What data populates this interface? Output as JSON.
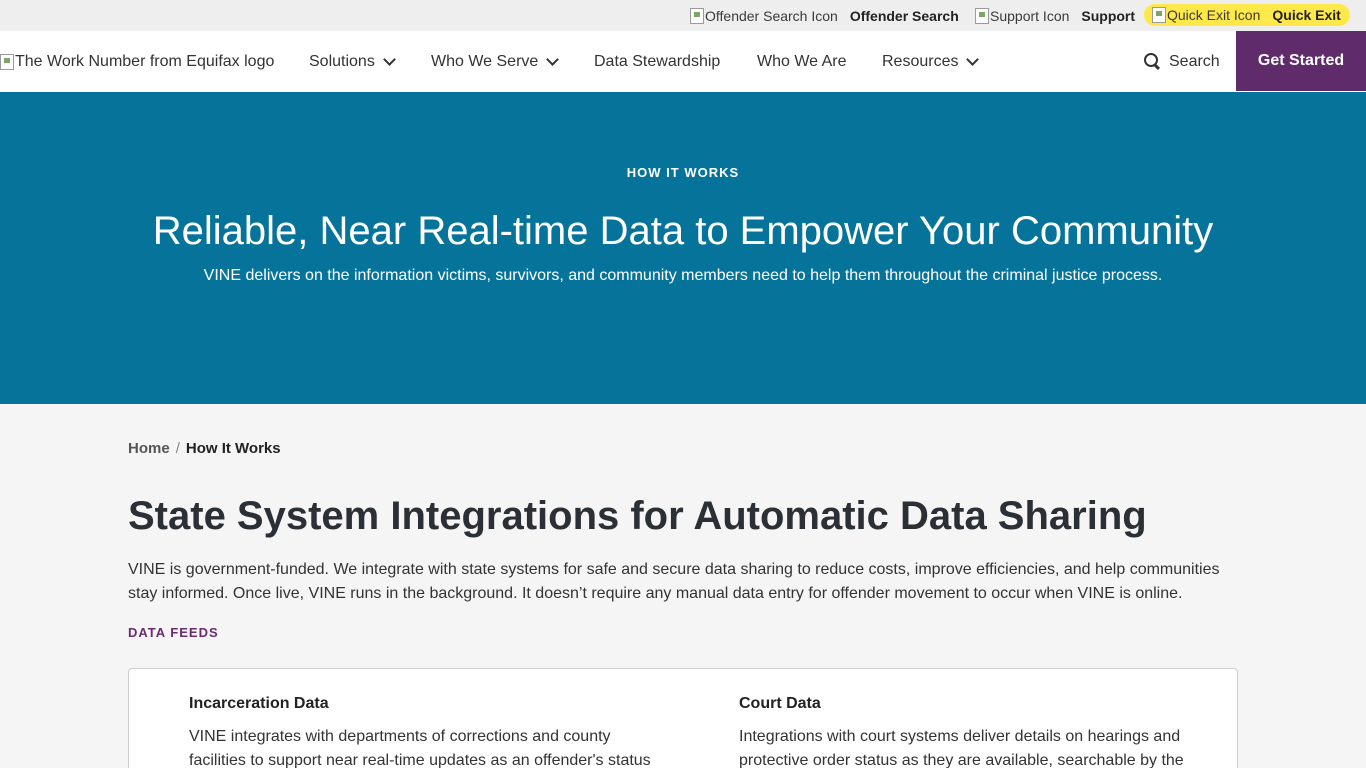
{
  "utility_bar": {
    "offender_search_icon_alt": "Offender Search Icon",
    "offender_search_label": "Offender Search",
    "support_icon_alt": "Support Icon",
    "support_label": "Support",
    "quick_exit_icon_alt": "Quick Exit Icon",
    "quick_exit_label": "Quick Exit",
    "quick_exit_color": "#ffe94a"
  },
  "nav": {
    "logo_alt": "The Work Number from Equifax logo",
    "items": [
      {
        "label": "Solutions",
        "has_dropdown": true
      },
      {
        "label": "Who We Serve",
        "has_dropdown": true
      },
      {
        "label": "Data Stewardship",
        "has_dropdown": false
      },
      {
        "label": "Who We Are",
        "has_dropdown": false
      },
      {
        "label": "Resources",
        "has_dropdown": true
      }
    ],
    "search_label": "Search",
    "cta_label": "Get Started",
    "cta_color": "#5f2b6b"
  },
  "hero": {
    "eyebrow": "HOW IT WORKS",
    "title": "Reliable, Near Real-time Data to Empower Your Community",
    "subtitle": "VINE delivers on the information victims, survivors, and community members need to help them throughout the criminal justice process.",
    "background_color": "#06739b"
  },
  "breadcrumb": {
    "home": "Home",
    "separator": "/",
    "current": "How It Works"
  },
  "main": {
    "title": "State System Integrations for Automatic Data Sharing",
    "intro": "VINE is government-funded. We integrate with state systems for safe and secure data sharing to reduce costs, improve efficiencies, and help communities stay informed. Once live, VINE runs in the background. It doesn’t require any manual data entry for offender movement to occur when VINE is online.",
    "feeds_label": "DATA FEEDS",
    "feeds": [
      {
        "title": "Incarceration Data",
        "text": "VINE integrates with departments of corrections and county facilities to support near real-time updates as an offender's status"
      },
      {
        "title": "Court Data",
        "text": "Integrations with court systems deliver details on hearings and protective order status as they are available, searchable by the"
      }
    ]
  }
}
